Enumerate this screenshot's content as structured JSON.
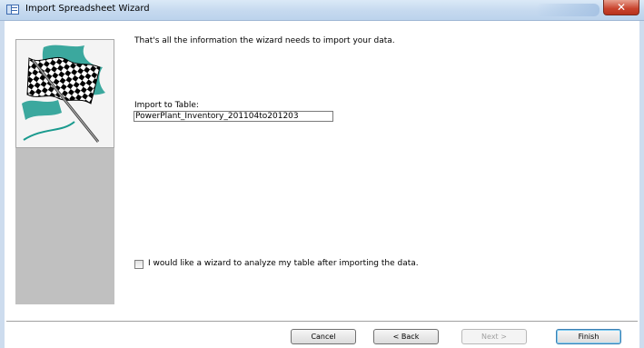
{
  "window": {
    "title": "Import Spreadsheet Wizard",
    "close_glyph": "✕"
  },
  "main": {
    "intro_text": "That's all the information the wizard needs to import your data.",
    "import_label": "Import to Table:",
    "table_name": "PowerPlant_Inventory_201104to201203",
    "analyze_checkbox_label": "I would like a wizard to analyze my table after importing the data.",
    "analyze_checked": false
  },
  "buttons": {
    "cancel": "Cancel",
    "back": "< Back",
    "next": "Next >",
    "finish": "Finish"
  },
  "colors": {
    "flag_teal": "#1a9a8e",
    "titlebar": "#c5d9ef",
    "close_red": "#c8432d"
  },
  "icons": [
    "table-icon",
    "checkered-flag-icon",
    "close-icon"
  ]
}
